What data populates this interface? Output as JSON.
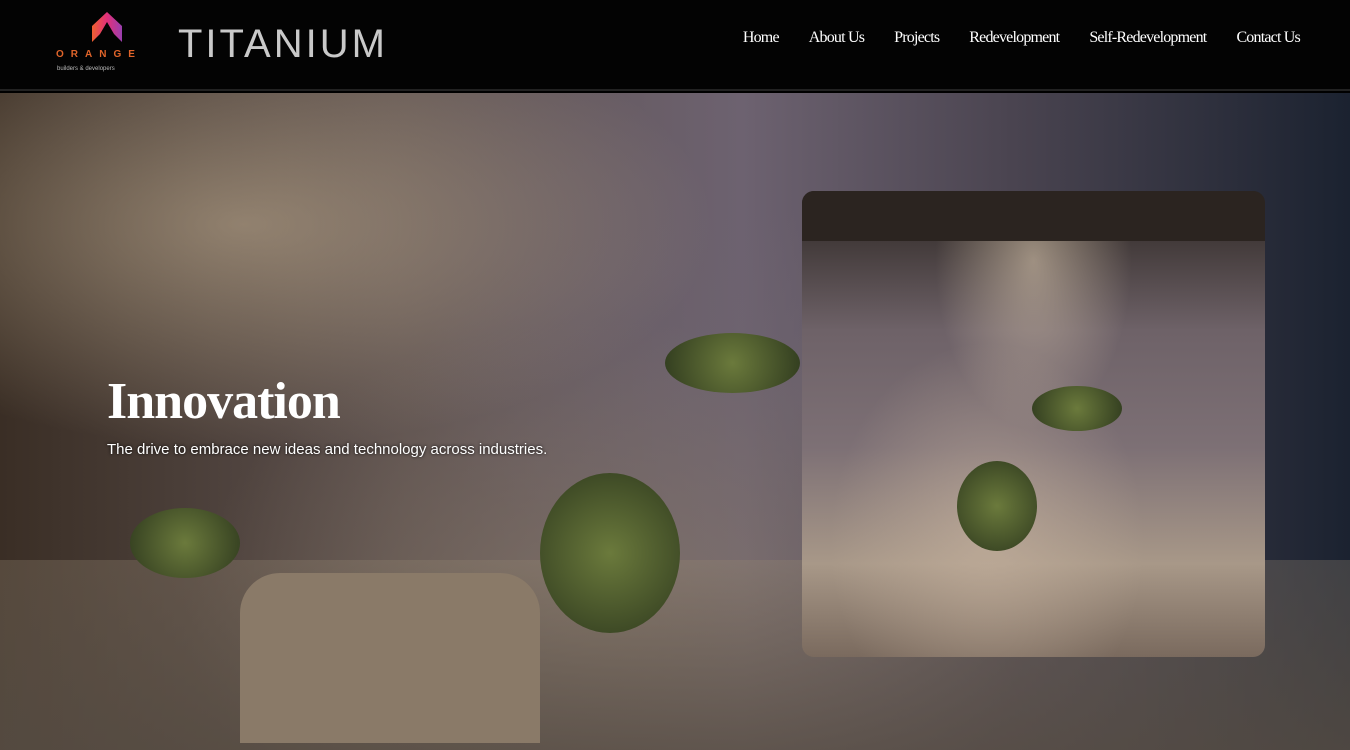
{
  "brand": {
    "orange": "ORANGE",
    "orange_tagline": "builders & developers",
    "product": "TITANIUM",
    "accent": "#e0642a"
  },
  "nav": [
    {
      "label": "Home"
    },
    {
      "label": "About Us"
    },
    {
      "label": "Projects"
    },
    {
      "label": "Redevelopment"
    },
    {
      "label": "Self-Redevelopment"
    },
    {
      "label": "Contact Us"
    }
  ],
  "hero": {
    "title": "Innovation",
    "subtitle": "The drive to embrace new ideas and technology across industries."
  }
}
